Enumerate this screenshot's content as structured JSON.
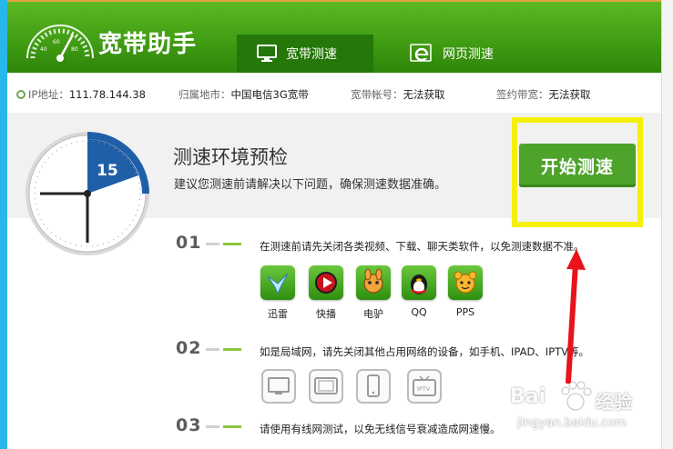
{
  "header": {
    "app_title": "宽带助手",
    "tabs": [
      {
        "label": "宽带测速",
        "icon": "monitor-icon",
        "active": true
      },
      {
        "label": "网页测速",
        "icon": "browser-e-icon",
        "active": false
      }
    ]
  },
  "infobar": {
    "ip_label": "IP地址：",
    "ip_value": "111.78.144.38",
    "region_label": "归属地市：",
    "region_value": "中国电信3G宽带",
    "account_label": "宽带帐号：",
    "account_value": "无法获取",
    "bandwidth_label": "签约带宽：",
    "bandwidth_value": "无法获取"
  },
  "panel": {
    "stopwatch_value": "15",
    "heading": "测速环境预检",
    "subtext": "建议您测速前请解决以下问题，确保测速数据准确。",
    "start_button": "开始测速"
  },
  "steps": [
    {
      "num": "01",
      "text": "在测速前请先关闭各类视频、下载、聊天类软件，以免测速数据不准。"
    },
    {
      "num": "02",
      "text": "如是局域网，请先关闭其他占用网络的设备，如手机、IPAD、IPTV等。"
    },
    {
      "num": "03",
      "text": "请使用有线网测试，以免无线信号衰减造成网速慢。"
    }
  ],
  "apps": [
    {
      "label": "迅雷",
      "icon": "xunlei-bird-icon"
    },
    {
      "label": "快播",
      "icon": "kuaibo-play-icon"
    },
    {
      "label": "电驴",
      "icon": "emule-donkey-icon"
    },
    {
      "label": "QQ",
      "icon": "qq-penguin-icon"
    },
    {
      "label": "PPS",
      "icon": "pps-mascot-icon"
    }
  ],
  "devices": [
    {
      "icon": "desktop-monitor-icon"
    },
    {
      "icon": "tablet-landscape-icon"
    },
    {
      "icon": "phone-icon"
    },
    {
      "icon": "iptv-icon",
      "label": "IPTV"
    }
  ],
  "watermark": {
    "brand_left": "Bai",
    "brand_right": "经验",
    "url": "jingyan.baidu.com"
  },
  "colors": {
    "header_green": "#3f9b12",
    "start_button": "#4ea32b",
    "highlight_box": "#f4f00a",
    "arrow_red": "#e8141c",
    "stopwatch_blue": "#1f5fa8"
  }
}
